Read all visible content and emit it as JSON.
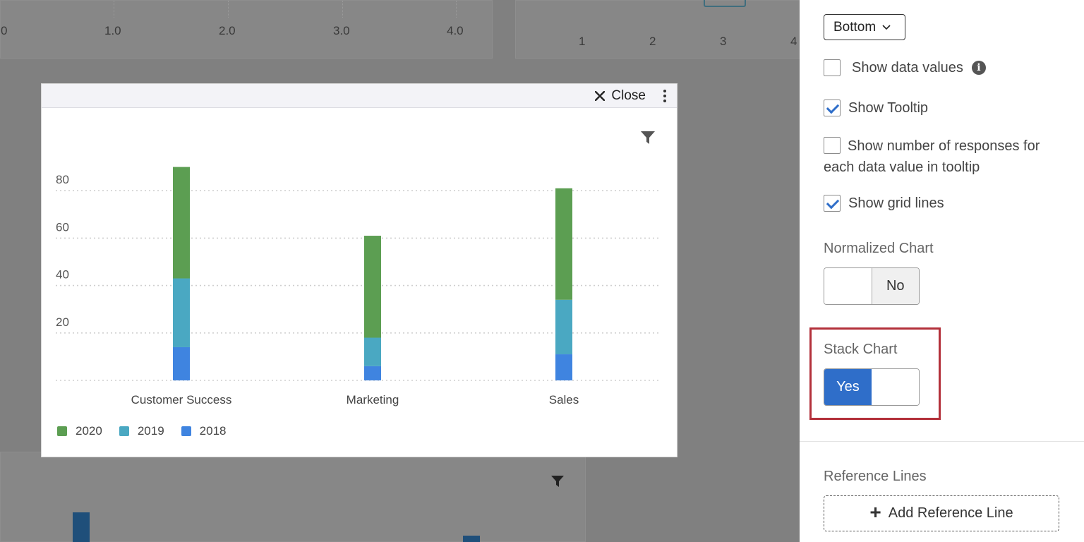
{
  "background": {
    "top_left_ticks": [
      "0",
      "1.0",
      "2.0",
      "3.0",
      "4.0"
    ],
    "top_right_ticks": [
      "1",
      "2",
      "3",
      "4"
    ]
  },
  "modal": {
    "close_label": "Close",
    "close_icon": "close-x-icon",
    "menu_icon": "kebab-menu-icon",
    "filter_icon": "filter-icon"
  },
  "chart_data": {
    "type": "bar",
    "stacked": true,
    "categories": [
      "Customer Success",
      "Marketing",
      "Sales"
    ],
    "series": [
      {
        "name": "2018",
        "values": [
          14,
          6,
          11
        ],
        "color": "#3f84e0"
      },
      {
        "name": "2019",
        "values": [
          29,
          12,
          23
        ],
        "color": "#4aa8c2"
      },
      {
        "name": "2020",
        "values": [
          47,
          43,
          47
        ],
        "color": "#5c9e52"
      }
    ],
    "yticks": [
      20,
      40,
      60,
      80
    ],
    "ylim": [
      0,
      100
    ],
    "grid": true,
    "legend_position": "bottom-left"
  },
  "panel": {
    "legend_position_value": "Bottom",
    "show_data_values": {
      "label": "Show data values",
      "checked": false
    },
    "show_tooltip": {
      "label": "Show Tooltip",
      "checked": true
    },
    "show_responses": {
      "label": "Show number of responses for each data value in tooltip",
      "checked": false
    },
    "show_grid_lines": {
      "label": "Show grid lines",
      "checked": true
    },
    "normalized_chart": {
      "label": "Normalized Chart",
      "value_label": "No"
    },
    "stack_chart": {
      "label": "Stack Chart",
      "value_label": "Yes"
    },
    "reference_lines": {
      "label": "Reference Lines",
      "add_label": "Add Reference Line"
    },
    "accent_color": "#2f6ec9",
    "highlight_color": "#b3303a"
  }
}
